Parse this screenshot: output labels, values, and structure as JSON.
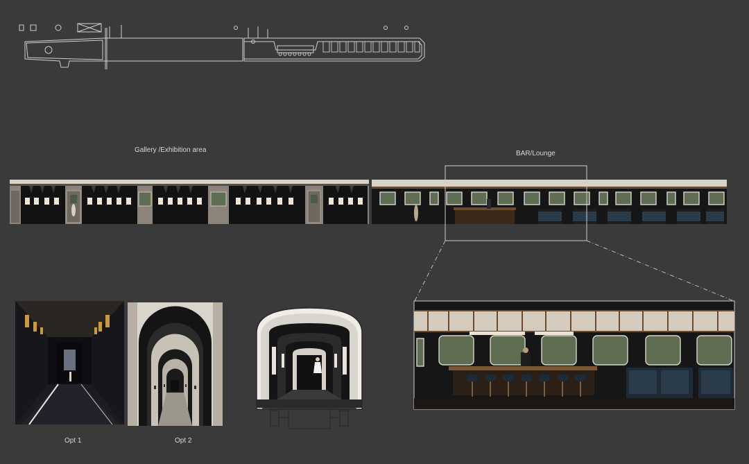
{
  "labels": {
    "gallery": "Gallery /Exhibition area",
    "bar": "BAR/Lounge",
    "opt1": "Opt 1",
    "opt2": "Opt 2"
  },
  "colors": {
    "background": "#3a3a3a",
    "wall_dark": "#141414",
    "wall_beige": "#8c847a",
    "window_green": "#5f6e52",
    "wood": "#6b4a2e",
    "seat_blue": "#20303c",
    "line": "#cfcfcf"
  },
  "icons": [
    "floor-plan",
    "gallery-elevation",
    "bar-lounge-elevation",
    "bar-lounge-detail",
    "opt1-render",
    "opt2-render",
    "carriage-section"
  ]
}
